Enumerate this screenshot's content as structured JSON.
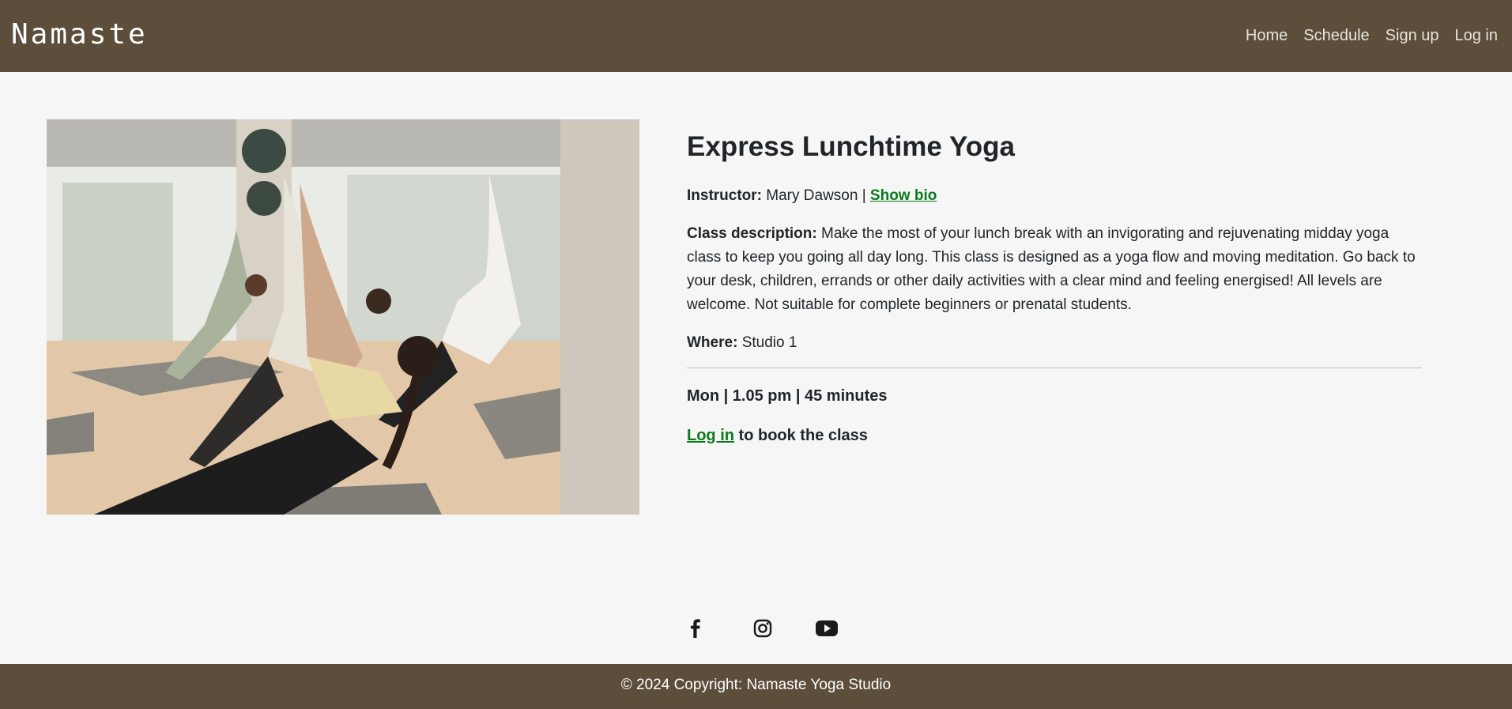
{
  "brand": "Namaste",
  "nav": {
    "home": "Home",
    "schedule": "Schedule",
    "signup": "Sign up",
    "login": "Log in"
  },
  "class_info": {
    "title": "Express Lunchtime Yoga",
    "instructor_label": "Instructor:",
    "instructor_name": "Mary Dawson |",
    "show_bio": "Show bio",
    "description_label": "Class description:",
    "description": "Make the most of your lunch break with an invigorating and rejuvenating midday yoga class to keep you going all day long. This class is designed as a yoga flow and moving meditation. Go back to your desk, children, errands or other daily activities with a clear mind and feeling energised! All levels are welcome. Not suitable for complete beginners or prenatal students.",
    "where_label": "Where:",
    "where_value": "Studio 1",
    "schedule": "Mon | 1.05 pm | 45 minutes",
    "login_link": "Log in",
    "booking_text": "to book the class"
  },
  "social": {
    "facebook": "facebook-icon",
    "instagram": "instagram-icon",
    "youtube": "youtube-icon"
  },
  "footer": {
    "copyright": "© 2024 Copyright: Namaste Yoga Studio"
  },
  "colors": {
    "brand_brown": "#5c4e3b",
    "link_green": "#0a7a1c",
    "background": "#f6f6f6"
  }
}
